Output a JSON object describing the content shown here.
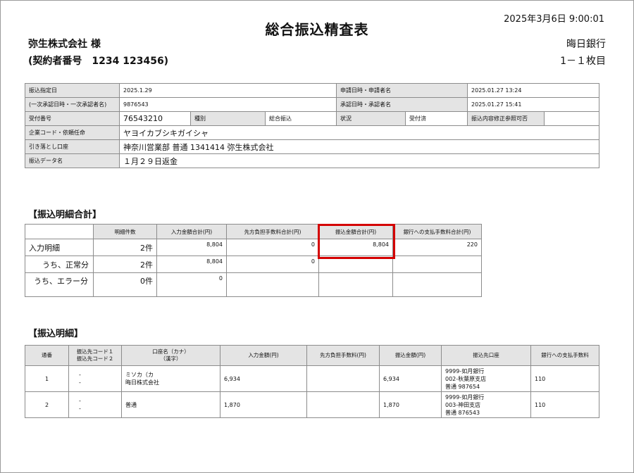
{
  "header": {
    "title": "総合振込精査表",
    "printed_at": "2025年3月6日 9:00:01",
    "company": "弥生株式会社 様",
    "contract": "(契約者番号　1234 123456)",
    "bank": "晦日銀行",
    "page": "1－１枚目"
  },
  "info": {
    "transfer_date_label": "振込指定日",
    "transfer_date": "2025.1.29",
    "apply_label": "申請日時・申請者名",
    "apply_value": "2025.01.27 13:24",
    "first_approval_label": "(一次承認日時・一次承認者名)",
    "first_approval_value": "9876543",
    "approval_label": "承認日時・承認者名",
    "approval_value": "2025.01.27 15:41",
    "receipt_label": "受付番号",
    "receipt_value": "76543210",
    "kind_label": "種別",
    "kind_value": "総合振込",
    "status_label": "状況",
    "status_value": "受付済",
    "modify_label": "振込内容修正参照可否",
    "modify_value": "",
    "company_code_label": "企業コード・依頼任命",
    "company_code_value": "ヤヨイカブシキガイシャ",
    "debit_label": "引き落とし口座",
    "debit_value": "神奈川営業部 普通 1341414 弥生株式会社",
    "data_name_label": "振込データ名",
    "data_name_value": "１月２９日返金"
  },
  "summary": {
    "title": "【振込明細合計】",
    "headers": [
      "",
      "明細件数",
      "入力金額合計(円)",
      "先方負担手数料合計(円)",
      "振込金額合計(円)",
      "銀行への支払手数料合計(円)"
    ],
    "rows": [
      {
        "label": "入力明細",
        "count": "2件",
        "input": "8,804",
        "fee": "0",
        "transfer": "8,804",
        "bank_fee": "220"
      },
      {
        "label": "うち、正常分",
        "count": "2件",
        "input": "8,804",
        "fee": "0",
        "transfer": "",
        "bank_fee": ""
      },
      {
        "label": "うち、エラー分",
        "count": "0件",
        "input": "0",
        "fee": "",
        "transfer": "",
        "bank_fee": ""
      }
    ]
  },
  "details": {
    "title": "【振込明細】",
    "headers": {
      "seq": "通番",
      "code1": "振込先コード１",
      "code2": "振込先コード２",
      "name1": "口座名（カナ）",
      "name2": "（漢字）",
      "input": "入力金額(円)",
      "fee": "先方負担手数料(円)",
      "transfer": "振込金額(円)",
      "account": "振込先口座",
      "bank_fee": "銀行への支払手数料"
    },
    "rows": [
      {
        "seq": "1",
        "code1": "-",
        "code2": "-",
        "name1": "ミソカ（カ",
        "name2": "晦日株式会社",
        "input": "6,934",
        "fee": "",
        "transfer": "6,934",
        "acc1": "9999-如月銀行",
        "acc2": "002-秋葉原支店",
        "acc3": "普通 987654",
        "bank_fee": "110"
      },
      {
        "seq": "2",
        "code1": "-",
        "code2": "-",
        "name1": "普通",
        "name2": "",
        "input": "1,870",
        "fee": "",
        "transfer": "1,870",
        "acc1": "9999-如月銀行",
        "acc2": "003-神田支店",
        "acc3": "普通 876543",
        "bank_fee": "110"
      }
    ]
  },
  "colors": {
    "highlight": "#d40000",
    "header_bg": "#e4e4e4"
  }
}
